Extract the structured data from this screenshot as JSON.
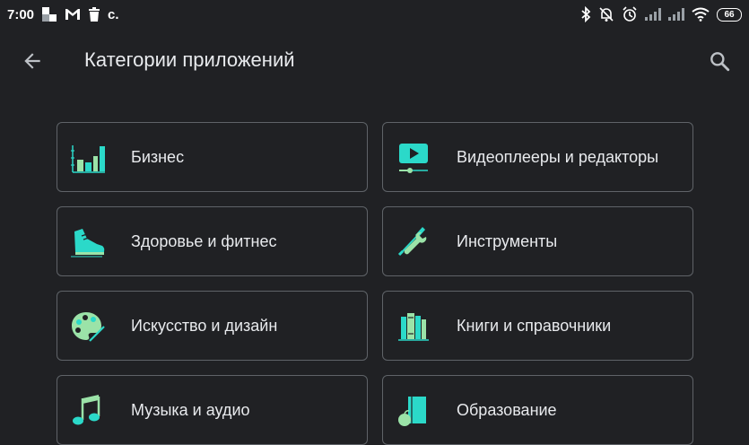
{
  "status_bar": {
    "time": "7:00",
    "carrier_short": "c.",
    "battery_level": "66"
  },
  "header": {
    "title": "Категории приложений"
  },
  "colors": {
    "background": "#202124",
    "card_border": "#5f6368",
    "icon_teal": "#2bd9c9",
    "icon_green": "#9be3a8"
  },
  "categories": [
    {
      "label": "Бизнес",
      "icon": "bar-chart-icon"
    },
    {
      "label": "Видеоплееры и редакторы",
      "icon": "video-player-icon"
    },
    {
      "label": "Здоровье и фитнес",
      "icon": "sneaker-icon"
    },
    {
      "label": "Инструменты",
      "icon": "tools-icon"
    },
    {
      "label": "Искусство и дизайн",
      "icon": "palette-icon"
    },
    {
      "label": "Книги и справочники",
      "icon": "books-icon"
    },
    {
      "label": "Музыка и аудио",
      "icon": "music-note-icon"
    },
    {
      "label": "Образование",
      "icon": "education-icon"
    }
  ]
}
